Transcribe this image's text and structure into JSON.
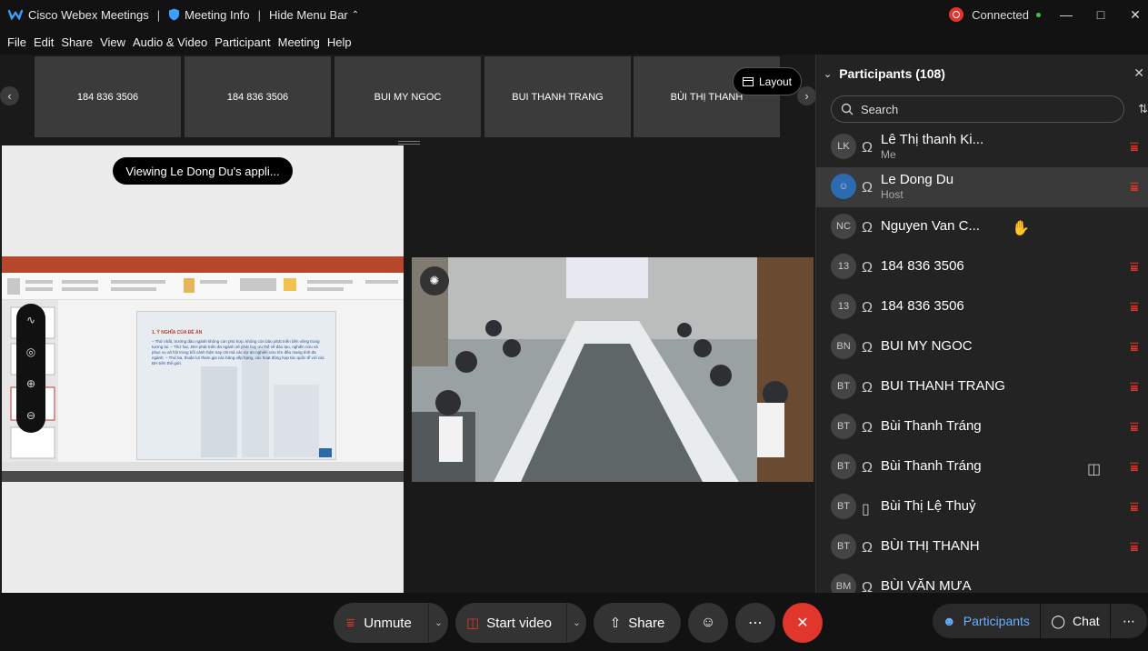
{
  "titlebar": {
    "app_name": "Cisco Webex Meetings",
    "meeting_info": "Meeting Info",
    "hide_menu": "Hide Menu Bar",
    "status": "Connected"
  },
  "menu": [
    "File",
    "Edit",
    "Share",
    "View",
    "Audio & Video",
    "Participant",
    "Meeting",
    "Help"
  ],
  "filmstrip": {
    "tiles": [
      "184 836 3506",
      "184 836 3506",
      "BUI MY NGOC",
      "BUI THANH TRANG",
      "BÙI THỊ THANH"
    ],
    "layout_label": "Layout"
  },
  "share": {
    "viewing_label": "Viewing Le Dong Du's appli...",
    "slide_heading": "1. Ý NGHĨA CỦA ĐỀ ÁN",
    "slide_text": "– Thứ nhất, trường đào ngành không còn phù hợp, không còn bảo phát triển bền vững trong tương lai. – Thứ hai, JEH phát triển đa ngành sẽ phát huy ưu thế về đào tạo, nghiên cứu và phục vụ xã hội trong bối cảnh hiện nay chỉ mà các dự án nghiên cứu lớn đều mang tính đa ngành. – Thứ ba, thuận lợi tham gia các bảng xếp hạng, các hoạt động hợp tác quốc tế với các ĐH trên thế giới."
  },
  "participants": {
    "header": "Participants (108)",
    "search_placeholder": "Search",
    "list": [
      {
        "initials": "LK",
        "name": "Lê Thị thanh Ki...",
        "role": "Me",
        "device": "headset",
        "extra": ""
      },
      {
        "initials": "",
        "name": "Le Dong Du",
        "role": "Host",
        "device": "headset",
        "extra": ""
      },
      {
        "initials": "NC",
        "name": "Nguyen Van C...",
        "role": "",
        "device": "headset",
        "extra": "hand"
      },
      {
        "initials": "13",
        "name": "184 836 3506",
        "role": "",
        "device": "headset",
        "extra": ""
      },
      {
        "initials": "13",
        "name": "184 836 3506",
        "role": "",
        "device": "headset",
        "extra": ""
      },
      {
        "initials": "BN",
        "name": "BUI MY NGOC",
        "role": "",
        "device": "headset",
        "extra": ""
      },
      {
        "initials": "BT",
        "name": "BUI THANH TRANG",
        "role": "",
        "device": "headset",
        "extra": ""
      },
      {
        "initials": "BT",
        "name": "Bùi Thanh Tráng",
        "role": "",
        "device": "headset",
        "extra": ""
      },
      {
        "initials": "BT",
        "name": "Bùi Thanh Tráng",
        "role": "",
        "device": "headset",
        "extra": "video"
      },
      {
        "initials": "BT",
        "name": "Bùi Thị Lệ Thuỷ",
        "role": "",
        "device": "phone",
        "extra": ""
      },
      {
        "initials": "BT",
        "name": "BÙI THỊ THANH",
        "role": "",
        "device": "headset",
        "extra": ""
      },
      {
        "initials": "BM",
        "name": "BÙI VĂN MƯA",
        "role": "",
        "device": "headset",
        "extra": ""
      }
    ]
  },
  "controls": {
    "unmute": "Unmute",
    "start_video": "Start video",
    "share": "Share",
    "participants": "Participants",
    "chat": "Chat"
  },
  "colors": {
    "accent_red": "#e0362c",
    "connected_green": "#3ec33e",
    "panel_bg": "#232323",
    "participants_blue": "#6ab0ff"
  }
}
